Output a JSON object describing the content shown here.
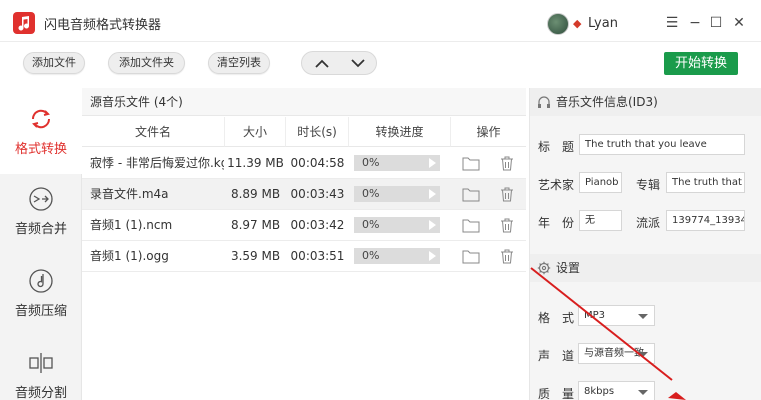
{
  "window": {
    "title": "闪电音频格式转换器",
    "username": "Lyan"
  },
  "toolbar": {
    "add_file": "添加文件",
    "add_folder": "添加文件夹",
    "clear_list": "清空列表",
    "start": "开始转换"
  },
  "nav": {
    "items": [
      {
        "label": "格式转换",
        "icon": "convert-icon",
        "active": true
      },
      {
        "label": "音频合并",
        "icon": "merge-icon",
        "active": false
      },
      {
        "label": "音频压缩",
        "icon": "compress-icon",
        "active": false
      },
      {
        "label": "音频分割",
        "icon": "split-icon",
        "active": false
      }
    ]
  },
  "list": {
    "header": "源音乐文件 (4个)",
    "columns": [
      "文件名",
      "大小",
      "时长(s)",
      "转换进度",
      "操作"
    ],
    "rows": [
      {
        "name": "寂悸 - 非常后悔爱过你.kg...",
        "size": "11.39 MB",
        "duration": "00:04:58",
        "progress": "0%",
        "progress_value": 0,
        "selected": false
      },
      {
        "name": "录音文件.m4a",
        "size": "8.89 MB",
        "duration": "00:03:43",
        "progress": "0%",
        "progress_value": 0,
        "selected": true
      },
      {
        "name": "音频1 (1).ncm",
        "size": "8.97 MB",
        "duration": "00:03:42",
        "progress": "0%",
        "progress_value": 0,
        "selected": false
      },
      {
        "name": "音频1 (1).ogg",
        "size": "3.59 MB",
        "duration": "00:03:51",
        "progress": "0%",
        "progress_value": 0,
        "selected": false
      }
    ]
  },
  "info": {
    "header": "音乐文件信息(ID3)",
    "title_label": "标　题",
    "title_value": "The truth that you leave",
    "artist_label": "艺术家",
    "artist_value": "Pianob",
    "album_label": "专辑",
    "album_value": "The truth that y",
    "year_label": "年　份",
    "year_value": "无",
    "genre_label": "流派",
    "genre_value": "139774_13934"
  },
  "settings": {
    "header": "设置",
    "format_label": "格　式",
    "format_value": "MP3",
    "channel_label": "声　道",
    "channel_value": "与源音频一致",
    "quality_label": "质　量",
    "quality_value": "8kbps"
  },
  "colors": {
    "accent_red": "#e0312e",
    "start_green": "#1a9b4b",
    "annotation_red": "#d81e1e"
  }
}
